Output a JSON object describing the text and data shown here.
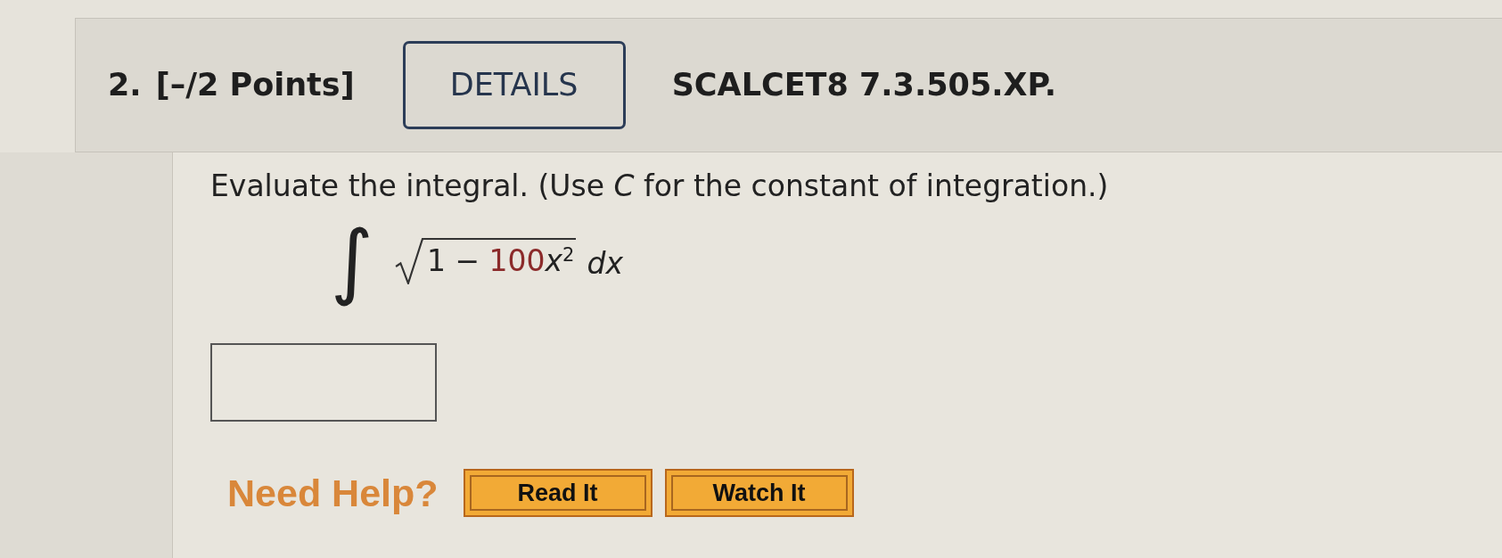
{
  "question": {
    "number": "2.",
    "points": "[–/2 Points]",
    "details_button": "DETAILS",
    "problem_code": "SCALCET8 7.3.505.XP."
  },
  "prompt": "Evaluate the integral. (Use *C* for the constant of integration.)",
  "integral": {
    "sign": "∫",
    "radicand": [
      {
        "text": "1 − ",
        "kind": "fixed"
      },
      {
        "text": "100",
        "kind": "parameter"
      },
      {
        "text": "*x*$^{2}$",
        "kind": "fixed"
      }
    ],
    "differential": "dx"
  },
  "help": {
    "label": "Need Help?",
    "buttons": [
      "Read It",
      "Watch It"
    ]
  }
}
